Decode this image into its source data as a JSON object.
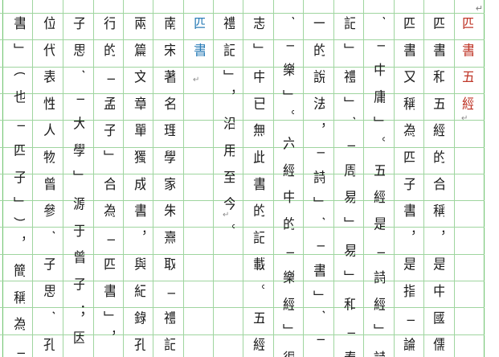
{
  "document": {
    "title_column": "四書五經",
    "subtitle_column": "四書",
    "text_columns": [
      "四書和五經的合稱，是中國儒",
      "四書又稱為四子書，是指「論語」、「孟",
      "、「中庸」。五經是「詩經」詩」、「尚",
      "記」禮」、「周易」易」和「春秋」。在",
      "一的說法，「詩」、「書」、「禮」、",
      "、「樂」。六經中的「樂經」很早就亡佚",
      "志」中已無此書的記載。五經中的「儀禮",
      "禮記」，沿用至今。",
      "南宋著名理學家朱熹取「禮記」中的",
      "兩篇文章單獨成書，與紀錄孔子言行「論",
      "行的「孟子」合為「四書」，依照其想法",
      "子思、「大學」源于曾子；因它們分別出",
      "位代表性人物曾參、子思、孔子、孟子，",
      "書」（也「四子」），簡稱為「四書」。東"
    ],
    "paragraph_mark": "↵",
    "return_mark": "↵"
  }
}
